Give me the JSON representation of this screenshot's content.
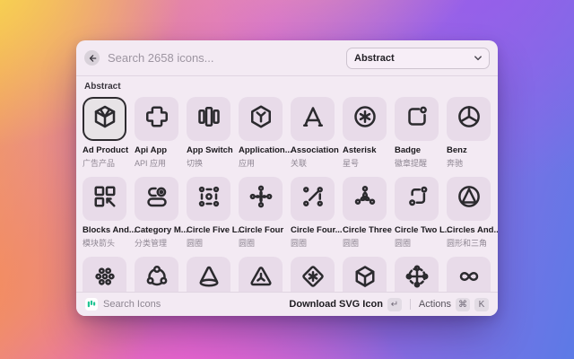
{
  "window": {
    "search_placeholder": "Search 2658 icons...",
    "category_dropdown": "Abstract",
    "section_label": "Abstract"
  },
  "grid": {
    "items": [
      {
        "icon": "box-3d-icon",
        "name": "Ad Product",
        "subtitle": "广告产品",
        "selected": true
      },
      {
        "icon": "api-app-icon",
        "name": "Api App",
        "subtitle": "API 应用"
      },
      {
        "icon": "app-switch-icon",
        "name": "App Switch",
        "subtitle": "切换"
      },
      {
        "icon": "application-hexagon-icon",
        "name": "Application...",
        "subtitle": "应用"
      },
      {
        "icon": "association-icon",
        "name": "Association",
        "subtitle": "关联"
      },
      {
        "icon": "asterisk-circle-icon",
        "name": "Asterisk",
        "subtitle": "星号"
      },
      {
        "icon": "badge-icon",
        "name": "Badge",
        "subtitle": "徽章提醒"
      },
      {
        "icon": "benz-icon",
        "name": "Benz",
        "subtitle": "奔驰"
      },
      {
        "icon": "blocks-arrow-icon",
        "name": "Blocks And...",
        "subtitle": "模块箭头"
      },
      {
        "icon": "category-management-icon",
        "name": "Category M...",
        "subtitle": "分类管理"
      },
      {
        "icon": "circle-five-line-icon",
        "name": "Circle Five L...",
        "subtitle": "圆圈"
      },
      {
        "icon": "circle-four-icon",
        "name": "Circle Four",
        "subtitle": "圆圈"
      },
      {
        "icon": "circle-four-line-icon",
        "name": "Circle Four...",
        "subtitle": "圆圈"
      },
      {
        "icon": "circle-three-icon",
        "name": "Circle Three",
        "subtitle": "圆圈"
      },
      {
        "icon": "circle-two-line-icon",
        "name": "Circle Two L...",
        "subtitle": "圆圈"
      },
      {
        "icon": "circles-triangles-icon",
        "name": "Circles And...",
        "subtitle": "圆形和三角"
      },
      {
        "icon": "dots-cluster-icon"
      },
      {
        "icon": "circle-nodes-icon"
      },
      {
        "icon": "cone-icon"
      },
      {
        "icon": "triangle-y-icon"
      },
      {
        "icon": "diamond-asterisk-icon"
      },
      {
        "icon": "cube-wireframe-icon"
      },
      {
        "icon": "move-cross-icon"
      },
      {
        "icon": "infinity-icon"
      }
    ]
  },
  "footer": {
    "brand_label": "Search Icons",
    "download_label": "Download SVG Icon",
    "enter_key": "↵",
    "actions_label": "Actions",
    "cmd_key": "⌘",
    "k_key": "K"
  },
  "colors": {
    "logo_green": "#1fc493",
    "icon_stroke": "#2b2a2e",
    "tile_background": "#e8dbe9",
    "window_background": "#f3eaf3",
    "selected_border": "#2e2b30"
  }
}
